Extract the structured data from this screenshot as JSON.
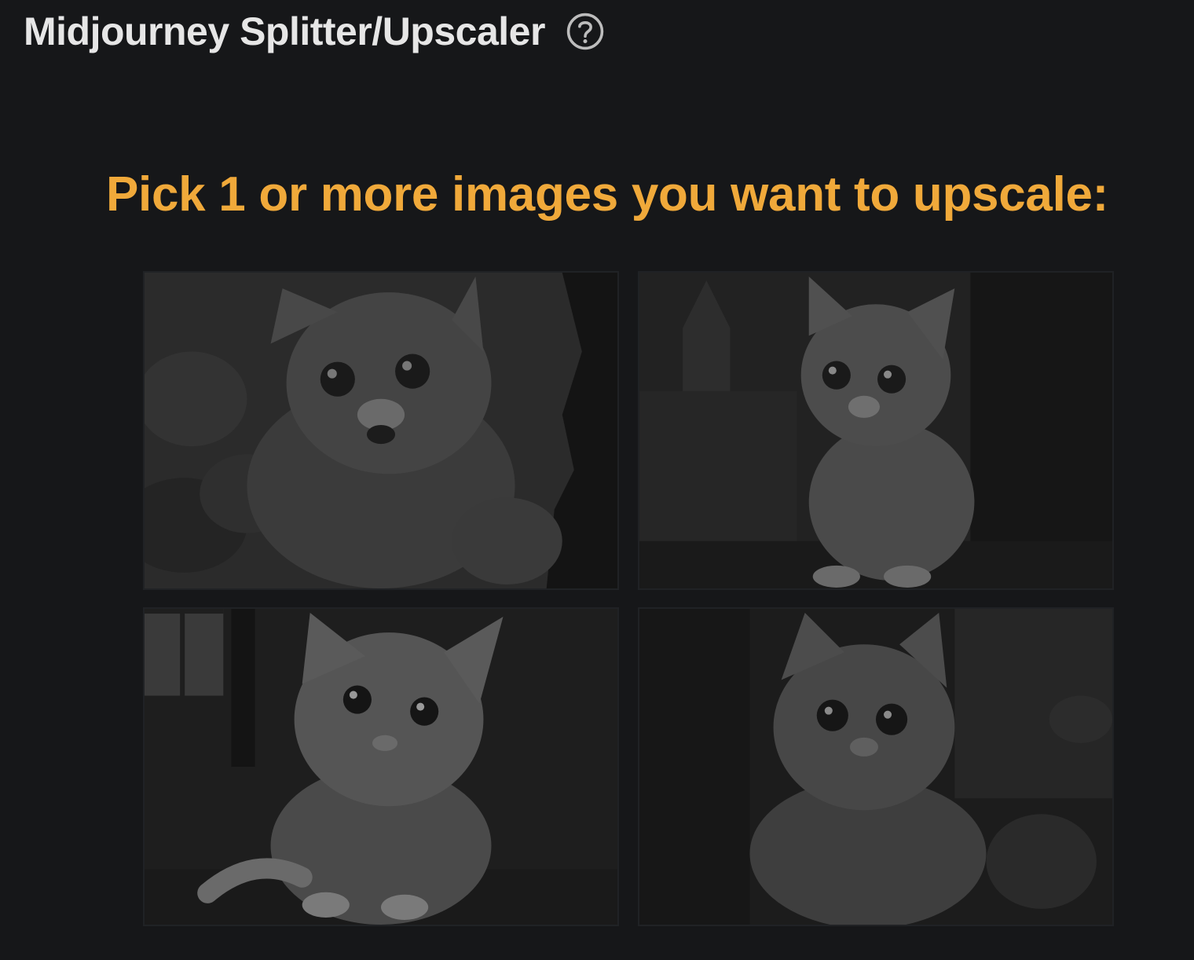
{
  "header": {
    "title": "Midjourney Splitter/Upscaler",
    "help_icon": "question-circle-icon"
  },
  "main": {
    "prompt": "Pick 1 or more images you want to upscale:"
  },
  "grid": {
    "tiles": [
      {
        "subject": "kitten"
      },
      {
        "subject": "kitten"
      },
      {
        "subject": "kitten"
      },
      {
        "subject": "kitten"
      }
    ]
  },
  "colors": {
    "background": "#161719",
    "title": "#e6e6e6",
    "accent": "#f0a93a",
    "tile_border": "#202225"
  }
}
